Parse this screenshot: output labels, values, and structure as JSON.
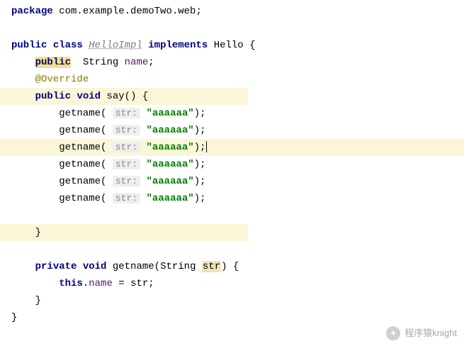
{
  "code": {
    "kw_package": "package",
    "pkg_name": "com.example.demoTwo.web;",
    "kw_public": "public",
    "kw_class": "class",
    "class_name": "HelloImpl",
    "kw_implements": "implements",
    "iface_name": "Hello",
    "brace_open": "{",
    "brace_close": "}",
    "kw_public2": "public",
    "type_string": "String",
    "field_name": "name",
    "semi": ";",
    "annotation": "@Override",
    "kw_void": "void",
    "method_say": "say",
    "parens": "()",
    "calls": [
      {
        "fn": "getname",
        "hint": "str:",
        "arg": "\"aaaaaa\"",
        "tail": ");"
      },
      {
        "fn": "getname",
        "hint": "str:",
        "arg": "\"aaaaaa\"",
        "tail": ");"
      },
      {
        "fn": "getname",
        "hint": "str:",
        "arg": "\"aaaaaa\"",
        "tail": ");"
      },
      {
        "fn": "getname",
        "hint": "str:",
        "arg": "\"aaaaaa\"",
        "tail": ");"
      },
      {
        "fn": "getname",
        "hint": "str:",
        "arg": "\"aaaaaa\"",
        "tail": ");"
      },
      {
        "fn": "getname",
        "hint": "str:",
        "arg": "\"aaaaaa\"",
        "tail": ");"
      }
    ],
    "kw_private": "private",
    "method_getname": "getname",
    "param_type": "String",
    "param_name": "str",
    "paren_open": "(",
    "paren_close": ")",
    "kw_this": "this",
    "dot": ".",
    "assign": " = ",
    "rhs": "str;"
  },
  "watermark": {
    "text": "程序猿knight"
  }
}
